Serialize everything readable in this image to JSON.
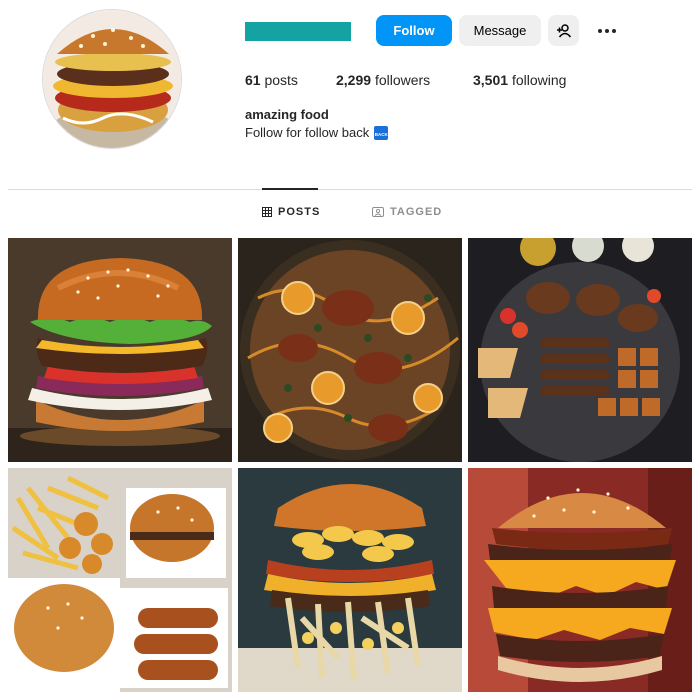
{
  "profile": {
    "follow_label": "Follow",
    "message_label": "Message",
    "more_label": "•••",
    "posts_count": "61",
    "posts_label": "posts",
    "followers_count": "2,299",
    "followers_label": "followers",
    "following_count": "3,501",
    "following_label": "following",
    "bio_name": "amazing food",
    "bio_text": "Follow for follow back",
    "bio_emoji_text": "BACK"
  },
  "tabs": [
    {
      "label": "POSTS",
      "icon": "grid-icon",
      "active": true
    },
    {
      "label": "TAGGED",
      "icon": "tag-icon",
      "active": false
    }
  ],
  "colors": {
    "follow_button": "#0095f6",
    "username_bar": "#14a3a3",
    "secondary_button": "#efefef"
  },
  "posts": [
    {
      "subject": "classic cheeseburger"
    },
    {
      "subject": "chicken with orange slices in pan"
    },
    {
      "subject": "mixed grill platter"
    },
    {
      "subject": "fast food meal with fries and nuggets"
    },
    {
      "subject": "mac and cheese burger"
    },
    {
      "subject": "double cheeseburger with bacon"
    }
  ]
}
